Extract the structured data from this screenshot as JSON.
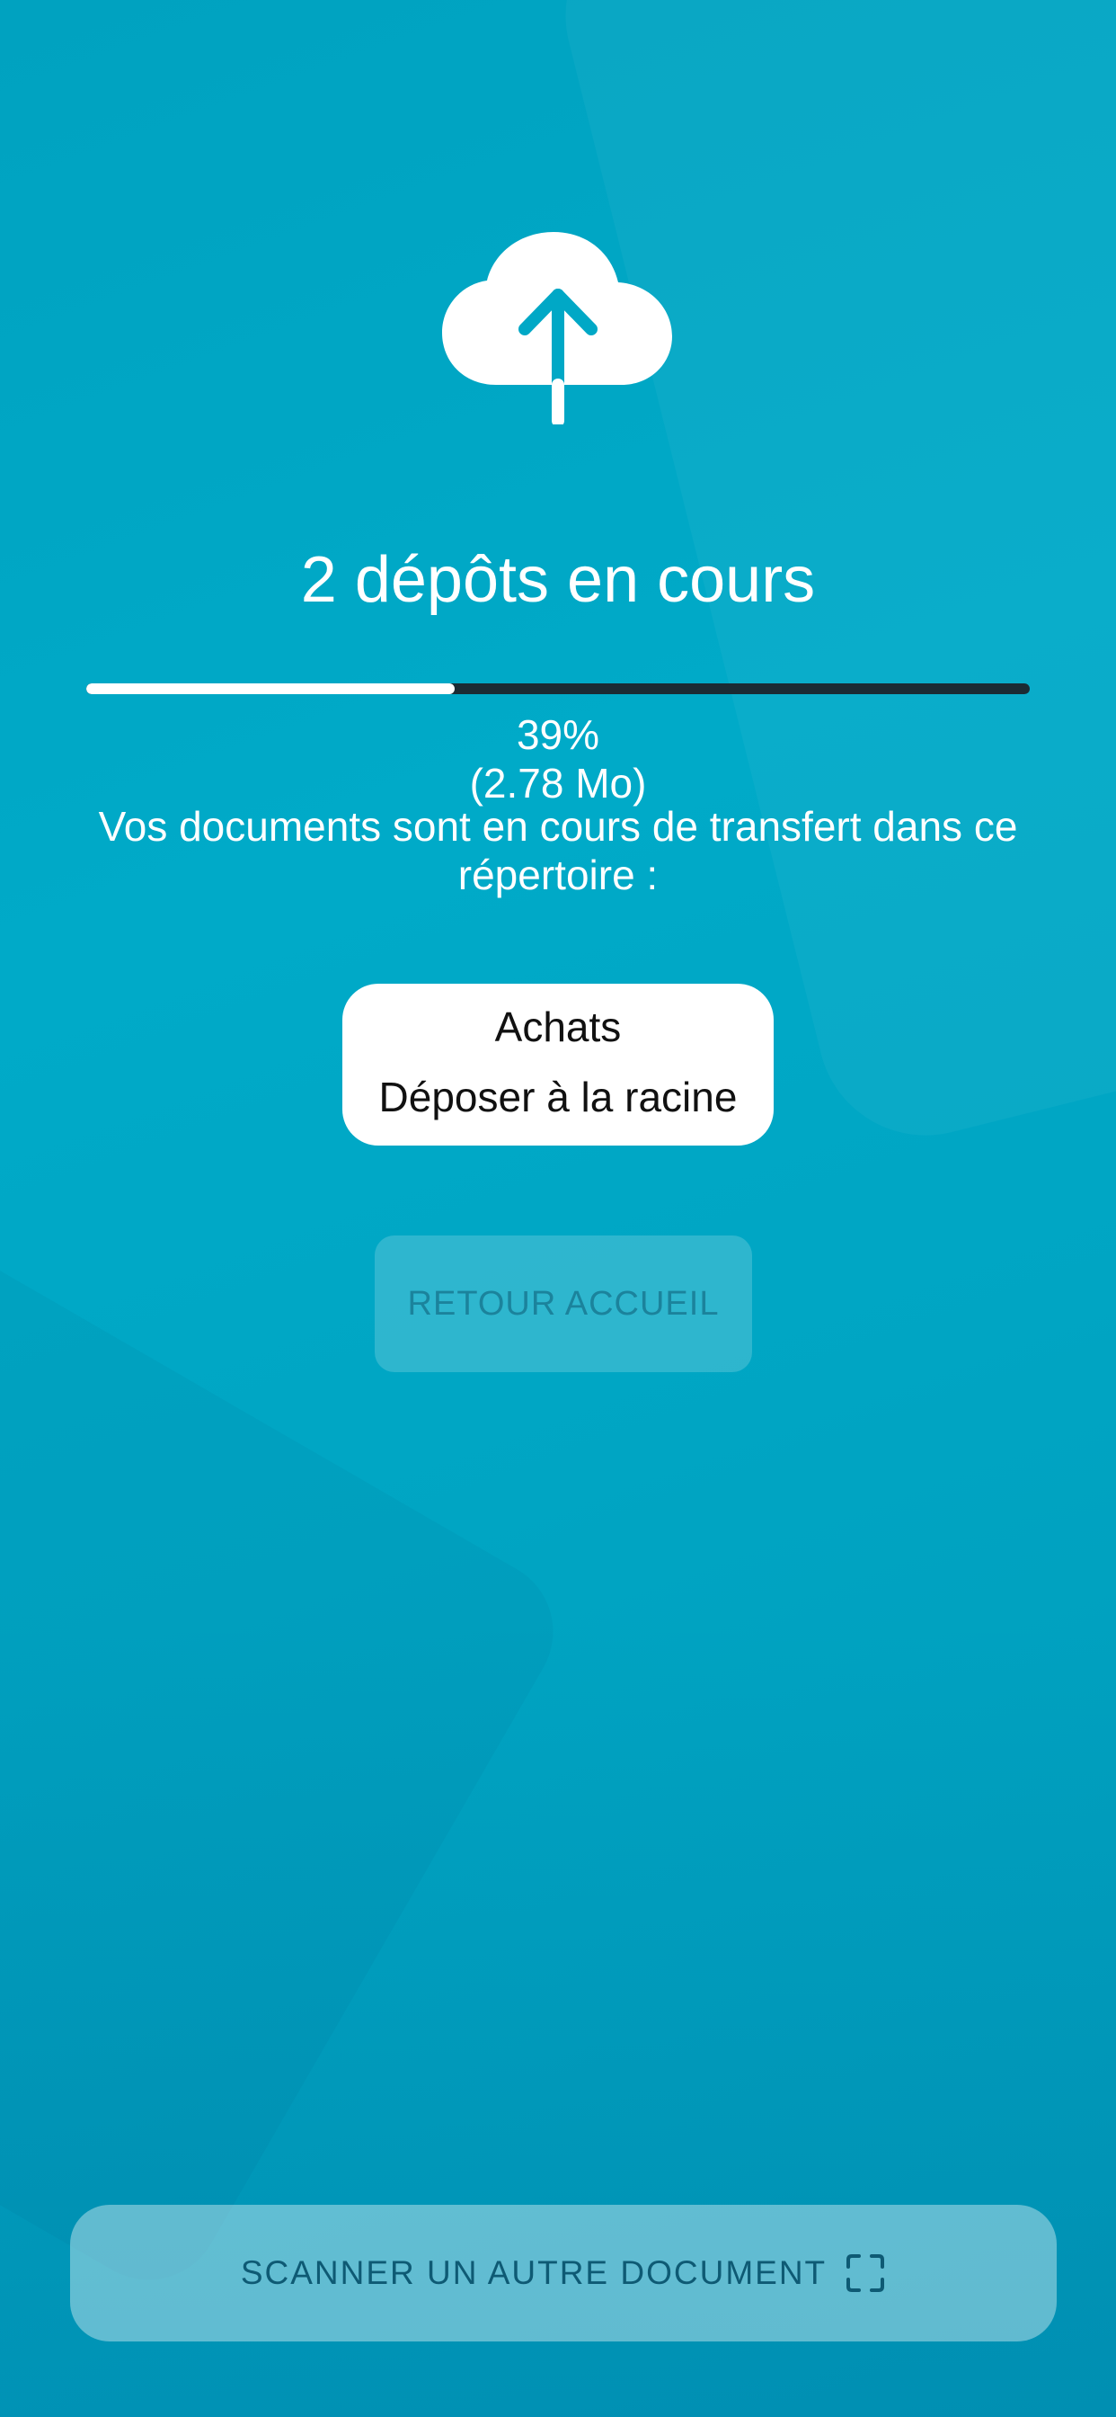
{
  "upload": {
    "title": "2 dépôts en cours",
    "progress_percent": 39,
    "percent_label": "39%",
    "size_label": "(2.78 Mo)",
    "description": "Vos documents sont en cours de transfert dans ce répertoire :"
  },
  "folder": {
    "name": "Achats",
    "subtitle": "Déposer à la racine"
  },
  "buttons": {
    "home_label": "RETOUR ACCUEIL",
    "scan_label": "SCANNER UN AUTRE DOCUMENT"
  },
  "icons": {
    "top": "cloud-upload-icon",
    "scan": "scan-frame-icon"
  },
  "colors": {
    "background": "#00a8c6",
    "progress_fill": "#ffffff",
    "progress_track": "#1b2b34",
    "scan_text": "#0e5a74"
  }
}
